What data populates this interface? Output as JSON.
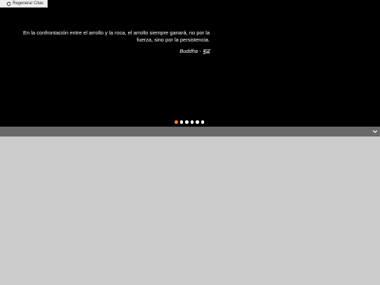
{
  "toolbar": {
    "regen_label": "Regenerar Citas",
    "regen_icon": "refresh-icon"
  },
  "quote": {
    "text": "En la confrontación entre el arrollo y la roca, el arrollo siempre ganará, no por la fuerza, sino por la persistencia.",
    "author": "Buddha - बुद्ध"
  },
  "carousel": {
    "dot_count": 6,
    "active_index": 0,
    "active_color": "#f07d2e",
    "inactive_color": "#ffffff"
  },
  "bar": {
    "toggle_icon": "chevron-down-icon",
    "color": "#6a6a6a"
  },
  "colors": {
    "hero_background": "#000000",
    "page_background": "#cccccc"
  }
}
